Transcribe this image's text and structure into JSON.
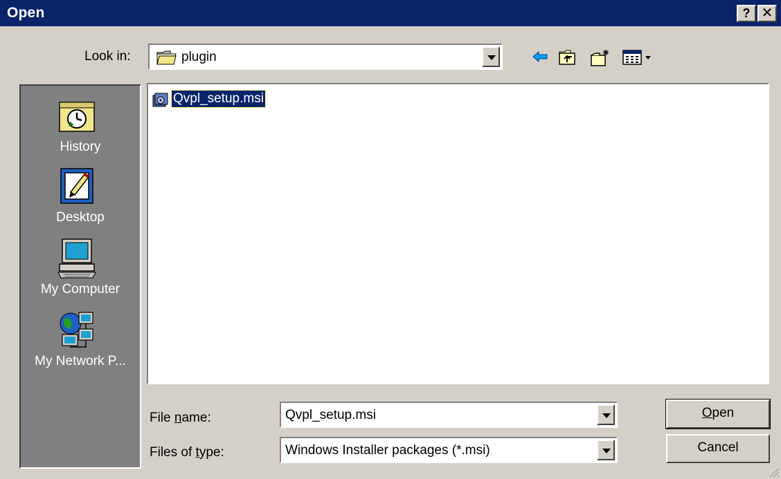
{
  "window": {
    "title": "Open",
    "help_glyph": "?",
    "close_glyph": "✕"
  },
  "lookin": {
    "label": "Look in:",
    "value": "plugin",
    "icon": "folder-icon"
  },
  "toolbar": {
    "icons": [
      "back-icon",
      "up-folder-icon",
      "new-folder-icon",
      "view-menu-icon"
    ]
  },
  "places": [
    {
      "label": "History",
      "icon": "history-icon"
    },
    {
      "label": "Desktop",
      "icon": "desktop-icon"
    },
    {
      "label": "My Computer",
      "icon": "computer-icon"
    },
    {
      "label": "My Network P...",
      "icon": "network-icon"
    }
  ],
  "files": [
    {
      "name": "Qvpl_setup.msi",
      "icon": "msi-package-icon",
      "selected": true
    }
  ],
  "filename": {
    "label_pre": "File ",
    "label_u": "n",
    "label_post": "ame:",
    "value": "Qvpl_setup.msi"
  },
  "filetype": {
    "label_pre": "Files of ",
    "label_u": "t",
    "label_post": "ype:",
    "value": "Windows Installer packages (*.msi)"
  },
  "buttons": {
    "open_u": "O",
    "open_rest": "pen",
    "cancel": "Cancel"
  },
  "colors": {
    "titlebar": "#0a246a",
    "face": "#d4d0c8",
    "selection": "#0a246a",
    "places_bg": "#808080"
  }
}
